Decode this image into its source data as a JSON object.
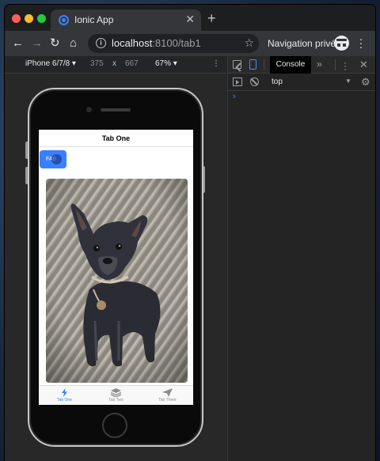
{
  "browser": {
    "tab_title": "Ionic App",
    "url_host": "localhost",
    "url_path": ":8100/tab1",
    "incognito_label": "Navigation privée"
  },
  "device_toolbar": {
    "device": "iPhone 6/7/8 ▾",
    "width": "375",
    "separator": "x",
    "height": "667",
    "zoom": "67% ▾"
  },
  "app": {
    "header_title": "Tab One",
    "fab_label": "FAB",
    "photo_subject": "dog photo",
    "tabs": [
      {
        "label": "Tab One",
        "icon": "flash-icon",
        "active": true
      },
      {
        "label": "Tab Two",
        "icon": "layers-icon",
        "active": false
      },
      {
        "label": "Tab Three",
        "icon": "send-icon",
        "active": false
      }
    ]
  },
  "devtools": {
    "console_tab": "Console",
    "context": "top",
    "prompt": "›"
  },
  "colors": {
    "accent": "#3880ff",
    "devtools_accent": "#4c8bf5"
  }
}
